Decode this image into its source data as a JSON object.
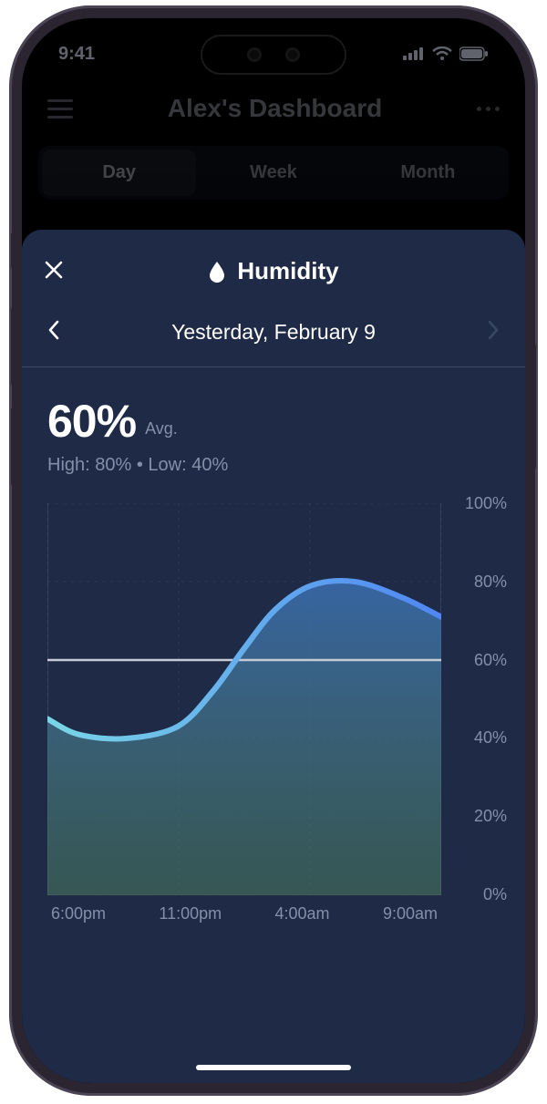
{
  "statusbar": {
    "time": "9:41"
  },
  "app": {
    "title": "Alex's Dashboard",
    "tabs": [
      {
        "label": "Day",
        "active": true
      },
      {
        "label": "Week",
        "active": false
      },
      {
        "label": "Month",
        "active": false
      }
    ]
  },
  "sheet": {
    "title": "Humidity",
    "date_label": "Yesterday, February 9",
    "prev_enabled": true,
    "next_enabled": false,
    "avg_value": "60%",
    "avg_label": "Avg.",
    "high_low_label": "High: 80% • Low: 40%"
  },
  "colors": {
    "sheet_bg": "#1e2a46",
    "line_start": "#79d6e6",
    "line_end": "#4f86f3",
    "fill_top": "#3b6fb1",
    "fill_bottom": "#4a7b5f",
    "avg_line": "#c6cbd8"
  },
  "chart_data": {
    "type": "area",
    "title": "Humidity",
    "xlabel": "",
    "ylabel": "",
    "ylim": [
      0,
      100
    ],
    "y_ticks": [
      0,
      20,
      40,
      60,
      80,
      100
    ],
    "y_tick_labels": [
      "0%",
      "20%",
      "40%",
      "60%",
      "80%",
      "100%"
    ],
    "x_tick_labels": [
      "6:00pm",
      "11:00pm",
      "4:00am",
      "9:00am"
    ],
    "average": 60,
    "series": [
      {
        "name": "Humidity",
        "x": [
          0,
          0.08,
          0.2,
          0.33,
          0.42,
          0.5,
          0.58,
          0.67,
          0.78,
          0.9,
          1.0
        ],
        "values": [
          45,
          41,
          40,
          43,
          52,
          63,
          73,
          79,
          80,
          76,
          71
        ]
      }
    ]
  }
}
